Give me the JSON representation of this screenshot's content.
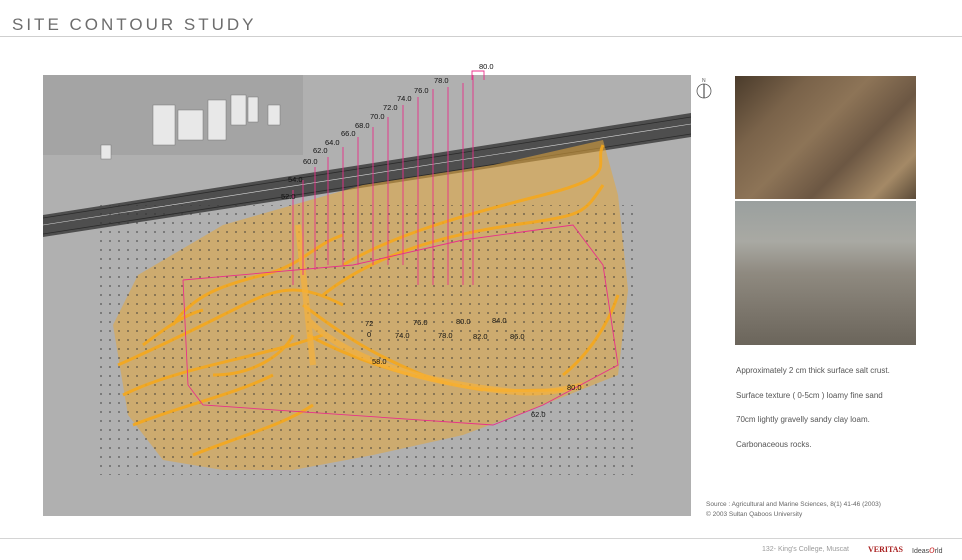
{
  "header": {
    "title": "SITE CONTOUR STUDY"
  },
  "compass": {
    "label": "N"
  },
  "map": {
    "contour_labels_top": [
      "80.0",
      "78.0",
      "76.0",
      "74.0",
      "72.0",
      "70.0",
      "68.0",
      "66.0",
      "64.0",
      "62.0",
      "60.0",
      "54.0",
      "52.0"
    ],
    "contour_labels_middle": [
      "72",
      "0",
      "76.0",
      "74.0",
      "78.0",
      "80.0",
      "82.0",
      "84.0",
      "86.0",
      "58.0",
      "80.0",
      "62.0"
    ]
  },
  "notes": [
    "Approximately  2 cm thick surface salt crust.",
    "Surface texture  ( 0-5cm ) loamy fine sand",
    "70cm lightly gravelly sandy clay loam.",
    "Carbonaceous rocks."
  ],
  "source": {
    "line1": "Source : Agricultural and Marine Sciences, 8(1) 41-46 (2003)",
    "line2": "© 2003 Sultan Qaboos University"
  },
  "footer": {
    "page": "132- King's College, Muscat",
    "brand": "VERITAS",
    "logo_pre": "Ideas",
    "logo_o": "o",
    "logo_post": "rld"
  },
  "colors": {
    "contour": "#f5a81c",
    "grid_line": "#e8308a",
    "dots": "#3a3a3a"
  }
}
